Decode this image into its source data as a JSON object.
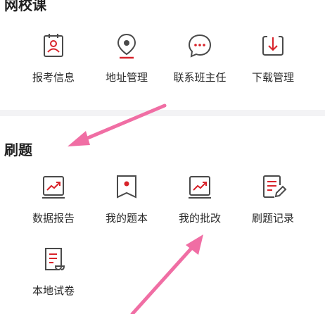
{
  "sections": {
    "online_course": {
      "title": "网校课",
      "items": [
        {
          "label": "报考信息",
          "icon": "registration-card-icon"
        },
        {
          "label": "地址管理",
          "icon": "location-pin-icon"
        },
        {
          "label": "联系班主任",
          "icon": "chat-bubble-icon"
        },
        {
          "label": "下载管理",
          "icon": "download-icon"
        }
      ]
    },
    "practice": {
      "title": "刷题",
      "items": [
        {
          "label": "数据报告",
          "icon": "data-report-icon"
        },
        {
          "label": "我的题本",
          "icon": "bookmark-book-icon"
        },
        {
          "label": "我的批改",
          "icon": "grading-icon"
        },
        {
          "label": "刷题记录",
          "icon": "edit-record-icon"
        },
        {
          "label": "本地试卷",
          "icon": "local-paper-icon"
        }
      ]
    }
  },
  "colors": {
    "icon_stroke": "#4a4a4a",
    "icon_accent": "#d8232a",
    "annotation_arrow": "#f06ea4"
  }
}
